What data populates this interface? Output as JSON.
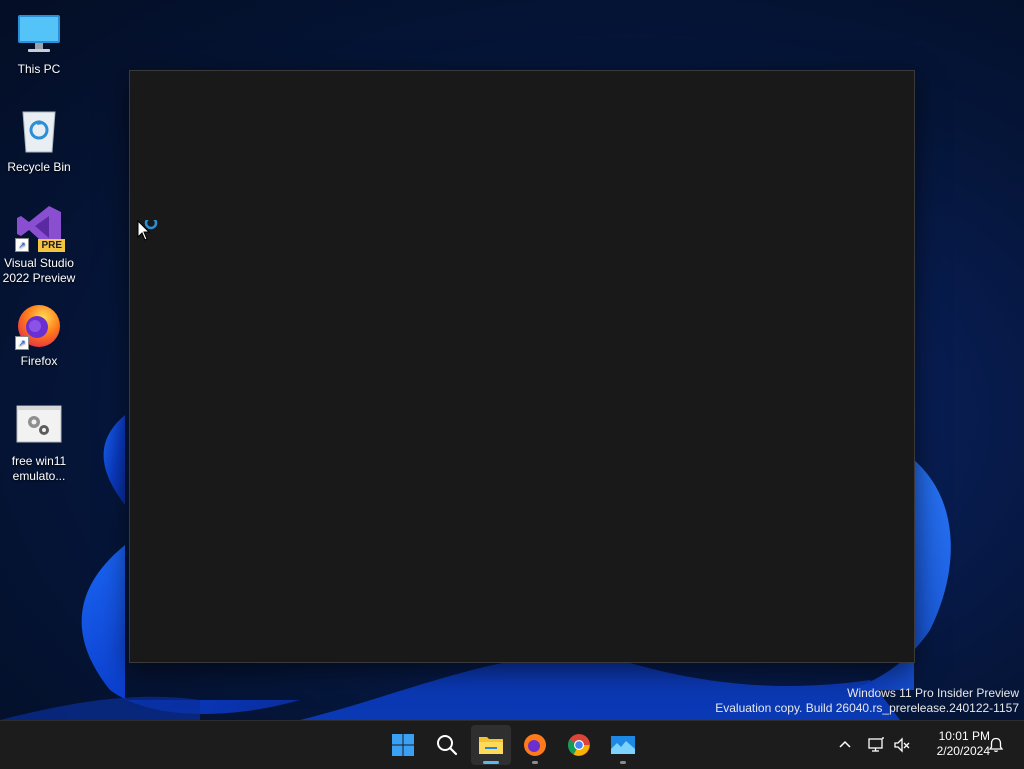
{
  "desktop": {
    "icons": [
      {
        "label": "This PC",
        "icon": "computer-monitor-icon"
      },
      {
        "label": "Recycle Bin",
        "icon": "recycle-bin-icon"
      },
      {
        "label": "Visual Studio 2022 Preview",
        "icon": "visual-studio-icon",
        "badge": "PRE",
        "shortcut": true
      },
      {
        "label": "Firefox",
        "icon": "firefox-icon",
        "shortcut": true
      },
      {
        "label": "free win11 emulato...",
        "icon": "settings-gear-app-icon"
      }
    ]
  },
  "window": {
    "state": "loading",
    "background": "#191919"
  },
  "watermark": {
    "line1": "Windows 11 Pro Insider Preview",
    "line2": "Evaluation copy. Build 26040.rs_prerelease.240122-1157"
  },
  "taskbar": {
    "apps": [
      {
        "name": "Start",
        "icon": "windows-start-icon",
        "running": false
      },
      {
        "name": "Search",
        "icon": "search-icon",
        "running": false
      },
      {
        "name": "File Explorer",
        "icon": "file-explorer-icon",
        "running": true,
        "active": true
      },
      {
        "name": "Firefox",
        "icon": "firefox-icon",
        "running": true
      },
      {
        "name": "Chrome",
        "icon": "chrome-icon",
        "running": false
      },
      {
        "name": "Emulator",
        "icon": "emulator-app-icon",
        "running": true
      }
    ],
    "tray": {
      "clock_time": "10:01 PM",
      "clock_date": "2/20/2024"
    }
  },
  "colors": {
    "taskbar_bg": "#1c1c1c",
    "accent": "#0078d4",
    "active_indicator": "#5cb7f0"
  }
}
